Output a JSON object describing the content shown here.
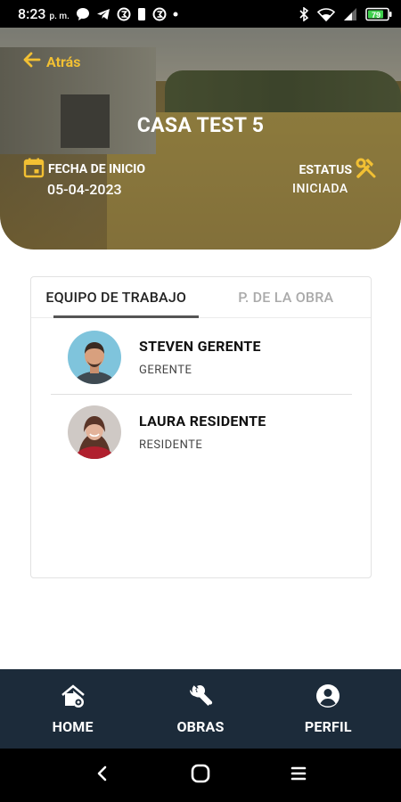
{
  "status_bar": {
    "time": "8:23",
    "ampm": "p. m.",
    "battery": "79"
  },
  "header": {
    "back_label": "Atrás",
    "title": "CASA TEST 5",
    "fecha_label": "FECHA DE INICIO",
    "fecha_value": "05-04-2023",
    "estatus_label": "ESTATUS",
    "estatus_value": "INICIADA"
  },
  "tabs": [
    {
      "label": "EQUIPO DE TRABAJO"
    },
    {
      "label": "P. DE LA OBRA"
    }
  ],
  "team": [
    {
      "name": "STEVEN GERENTE",
      "role": "GERENTE"
    },
    {
      "name": "LAURA RESIDENTE",
      "role": "RESIDENTE"
    }
  ],
  "bottom_nav": [
    {
      "label": "HOME",
      "icon": "home-icon"
    },
    {
      "label": "OBRAS",
      "icon": "wrench-icon"
    },
    {
      "label": "PERFIL",
      "icon": "account-icon"
    }
  ],
  "colors": {
    "accent": "#f2c033",
    "nav_bg": "#1c2b3a"
  }
}
